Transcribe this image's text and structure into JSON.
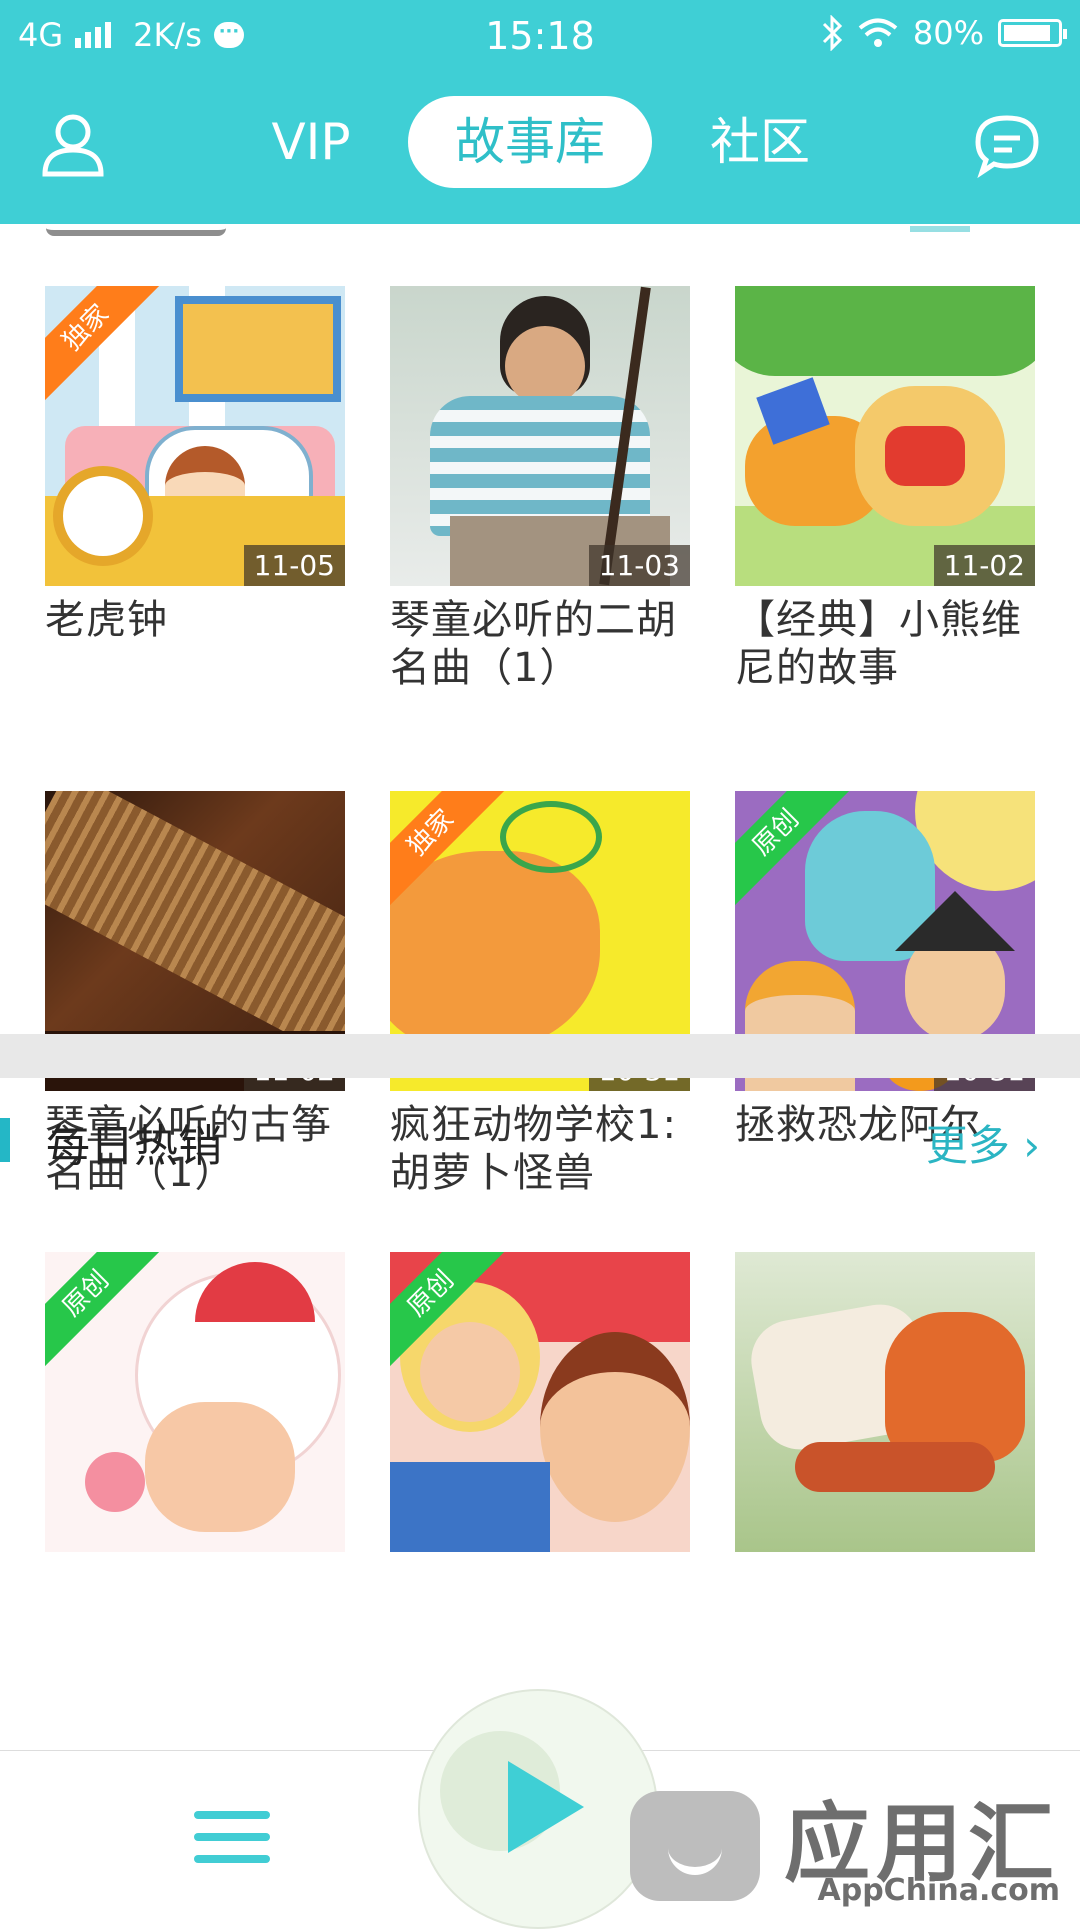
{
  "status_bar": {
    "network": "4G",
    "speed": "2K/s",
    "time": "15:18",
    "battery": "80%"
  },
  "nav": {
    "tabs": [
      {
        "label": "VIP"
      },
      {
        "label": "故事库"
      },
      {
        "label": "社区"
      }
    ],
    "active_tab": "故事库",
    "accent_color": "#3fcfd5"
  },
  "latest": {
    "items": [
      {
        "title": "老虎钟",
        "date": "11-05",
        "badge": "独家"
      },
      {
        "title": "琴童必听的二胡名曲（1）",
        "date": "11-03",
        "badge": ""
      },
      {
        "title": "【经典】小熊维尼的故事",
        "date": "11-02",
        "badge": ""
      },
      {
        "title": "琴童必听的古筝名曲（1）",
        "date": "11-02",
        "badge": ""
      },
      {
        "title": "疯狂动物学校1:胡萝卜怪兽",
        "date": "10-31",
        "badge": "独家"
      },
      {
        "title": "拯救恐龙阿尔",
        "date": "10-31",
        "badge": "原创"
      }
    ]
  },
  "hot": {
    "title": "每日热销",
    "more": "更多 ›",
    "items": [
      {
        "badge": "原创"
      },
      {
        "badge": "原创"
      },
      {
        "badge": ""
      }
    ]
  },
  "watermark": {
    "big": "应用汇",
    "small": "AppChina.com"
  }
}
